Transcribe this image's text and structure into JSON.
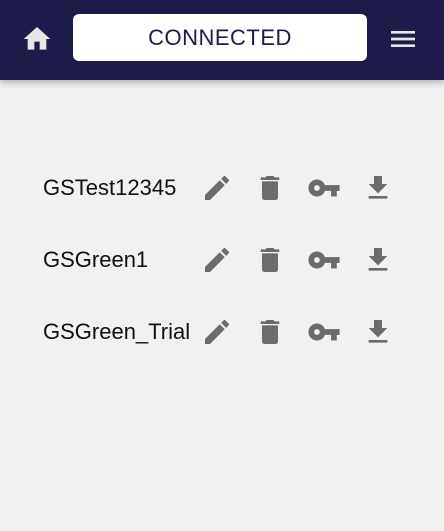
{
  "header": {
    "status_label": "CONNECTED",
    "home_icon": "home-icon",
    "menu_icon": "hamburger-menu-icon"
  },
  "colors": {
    "appbar_bg": "#1c1b4a",
    "page_bg": "#f0f1f3",
    "icon_gray": "#6b6b6b",
    "header_icon": "#e6e6e6"
  },
  "items": [
    {
      "name": "GSTest12345"
    },
    {
      "name": "GSGreen1"
    },
    {
      "name": "GSGreen_Trial"
    }
  ],
  "row_actions": [
    "edit-icon",
    "delete-icon",
    "key-icon",
    "download-icon"
  ]
}
